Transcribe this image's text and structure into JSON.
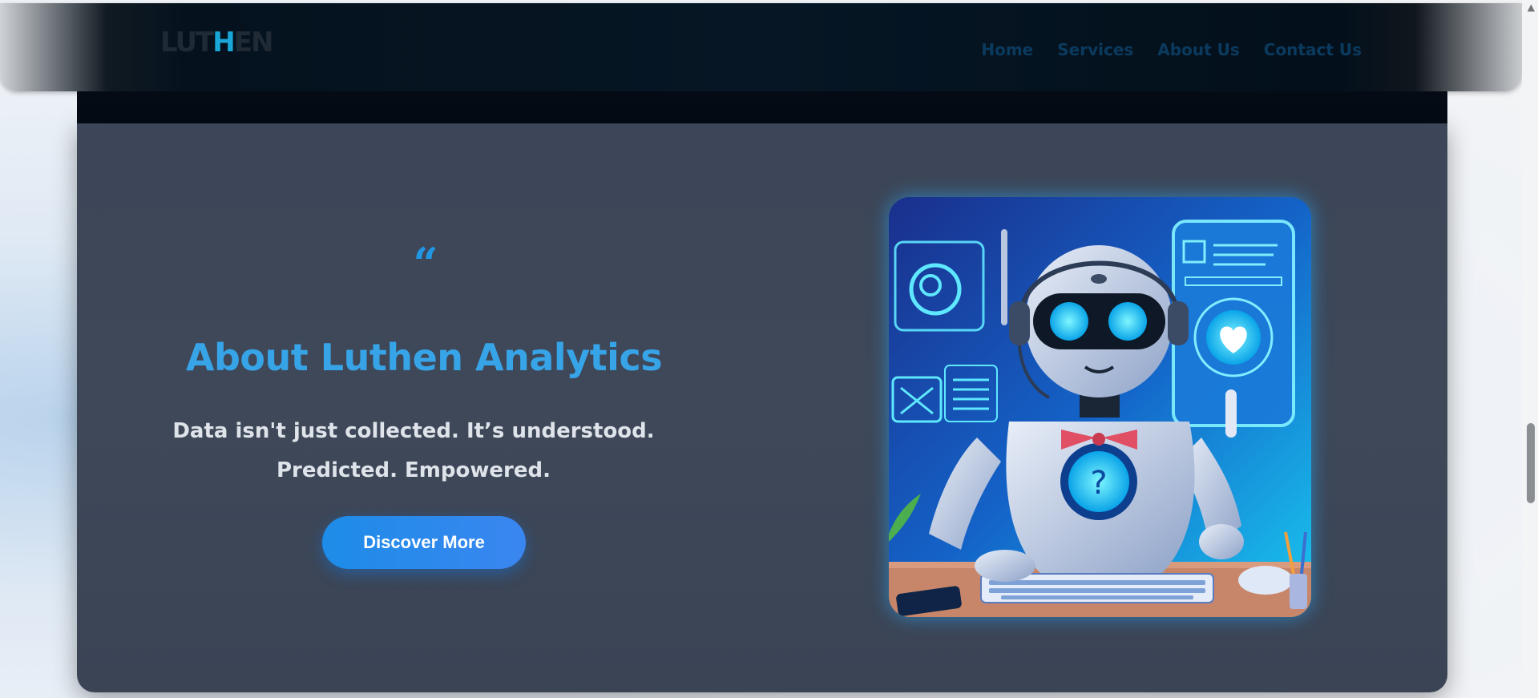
{
  "header": {
    "logo_text_left": "LUT",
    "logo_text_h": "H",
    "logo_text_right": "EN",
    "nav": [
      "Home",
      "Services",
      "About Us",
      "Contact Us"
    ]
  },
  "hero": {
    "quote_mark": "“",
    "title": "About Luthen Analytics",
    "tagline": "Data isn't just collected. It’s understood. Predicted. Empowered.",
    "cta_label": "Discover More",
    "illustration": "robot-customer-support-illustration"
  },
  "colors": {
    "accent": "#2196e3",
    "title": "#37a4e8",
    "card_bg": "#3e4859",
    "header_bg": "#061624"
  }
}
